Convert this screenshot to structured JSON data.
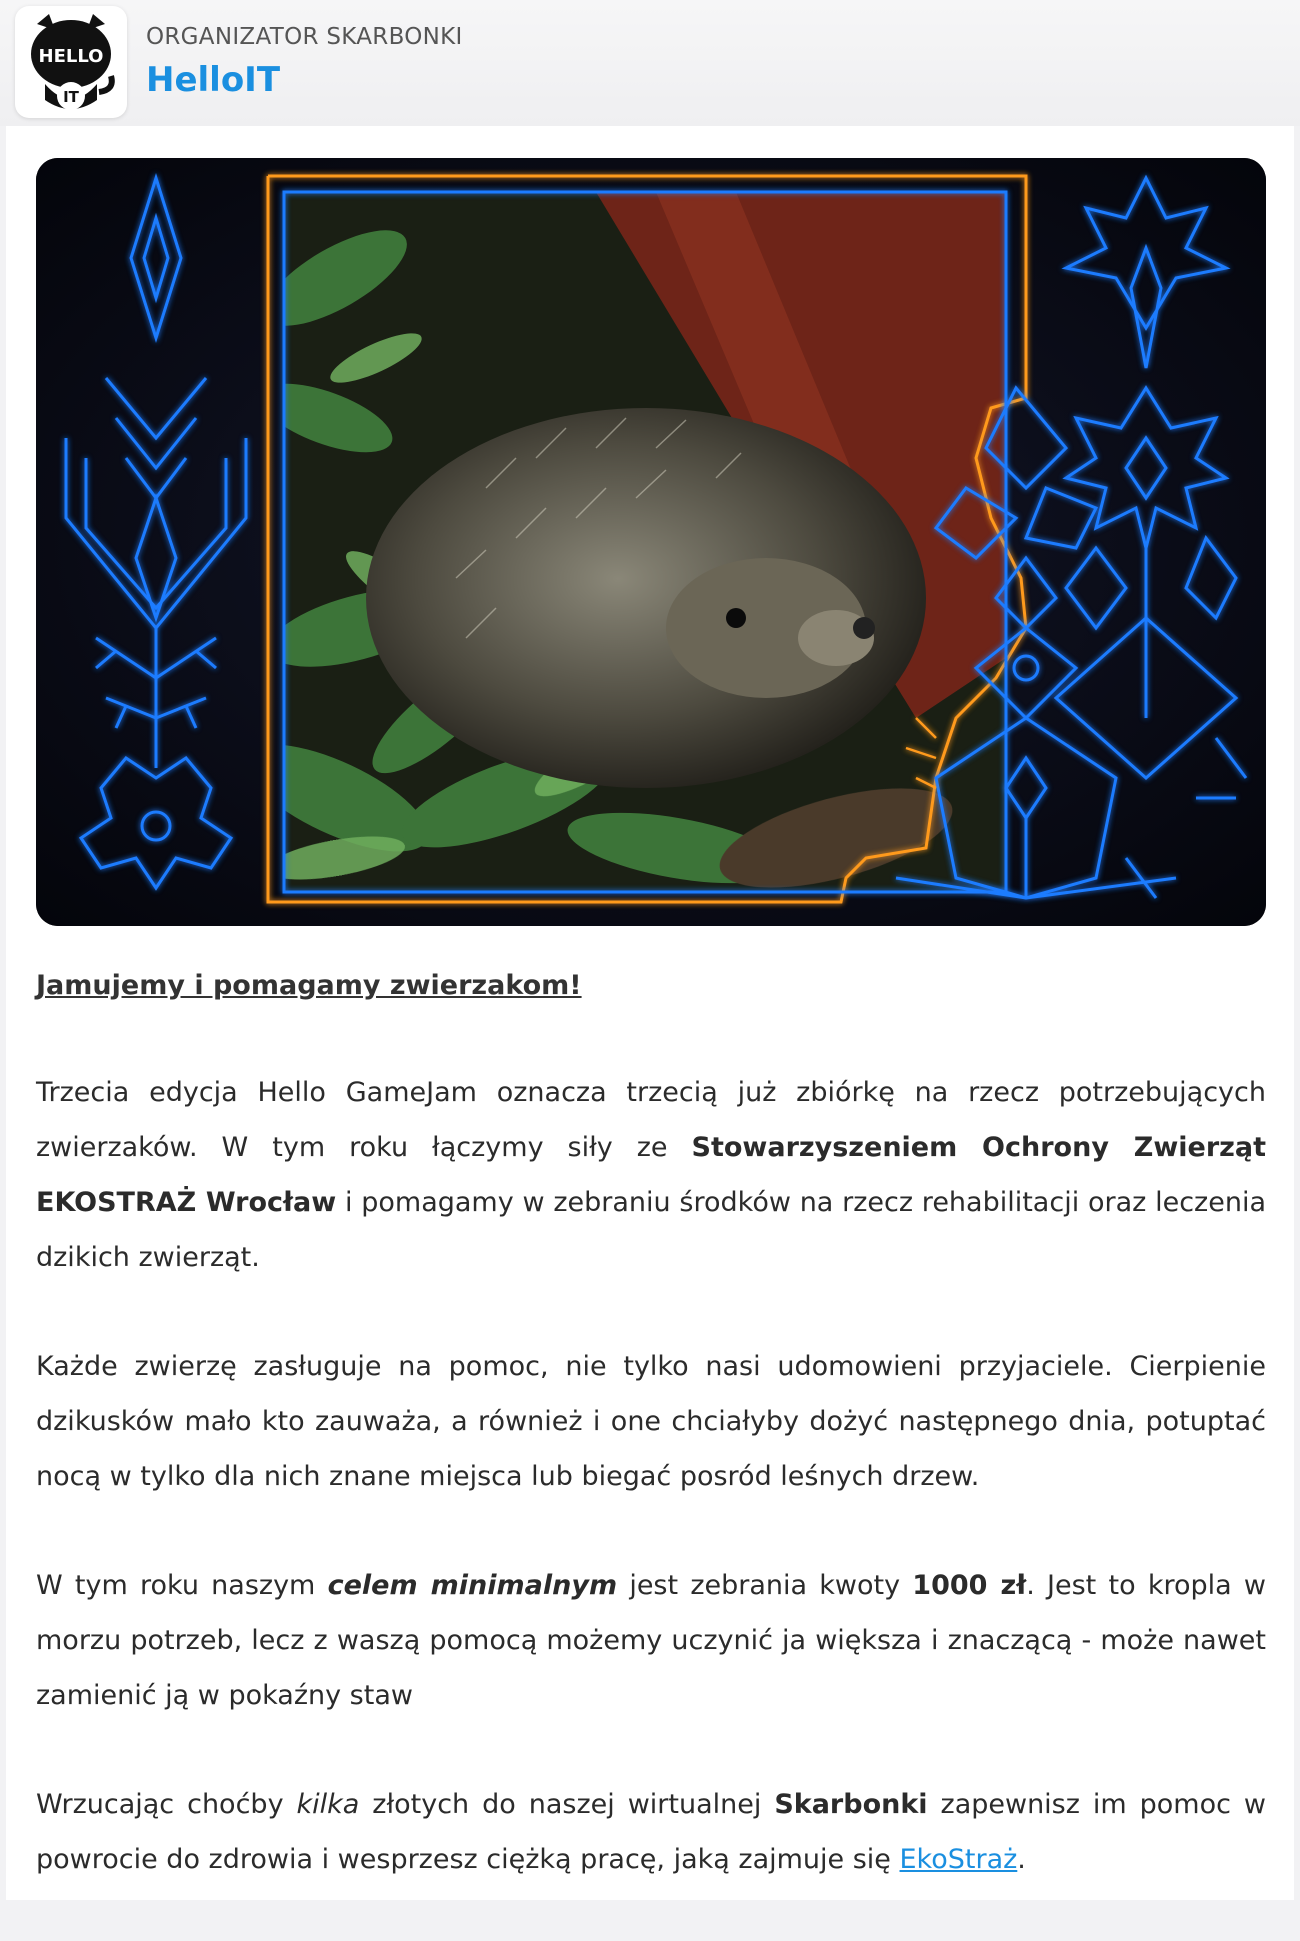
{
  "header": {
    "org_label": "ORGANIZATOR SKARBONKI",
    "org_name": "HelloIT",
    "logo_text_top": "HELLO",
    "logo_text_bottom": "IT"
  },
  "hero": {
    "image_alt": "Hedgehog among green ferns with neon folk ornaments",
    "accent_blue": "#1e7cff",
    "accent_orange": "#ff9a1e"
  },
  "article": {
    "heading": "Jamujemy i pomagamy zwierzakom!",
    "p1": {
      "t1": "Trzecia edycja Hello GameJam oznacza trzecią już zbiórkę na rzecz potrzebujących zwierzaków. W tym roku łączymy siły ze ",
      "b1": "Stowarzyszeniem Ochrony Zwierząt EKOSTRAŻ Wrocław",
      "t2": " i pomagamy w zebraniu środków na rzecz rehabilitacji oraz leczenia dzikich zwierząt."
    },
    "p2": "Każde zwierzę zasługuje na pomoc, nie tylko nasi udomowieni przyjaciele. Cierpienie dzikusków mało kto zauważa, a również i one chciałyby dożyć następnego dnia, potuptać nocą w tylko dla nich znane miejsca lub biegać posród leśnych drzew.",
    "p3": {
      "t1": "W tym roku naszym ",
      "bi": "celem minimalnym",
      "t2": " jest zebrania kwoty ",
      "b1": "1000 zł",
      "t3": ". Jest to kropla w morzu potrzeb, lecz z waszą pomocą możemy uczynić ja większa i znaczącą - może nawet zamienić ją w pokaźny staw"
    },
    "p4": {
      "t1": "Wrzucając choćby ",
      "i1": "kilka",
      "t2": " złotych do naszej wirtualnej ",
      "b1": "Skarbonki",
      "t3": " zapewnisz im pomoc w powrocie do zdrowia i wesprzesz ciężką pracę, jaką zajmuje się ",
      "link": "EkoStraż",
      "t4": "."
    }
  }
}
